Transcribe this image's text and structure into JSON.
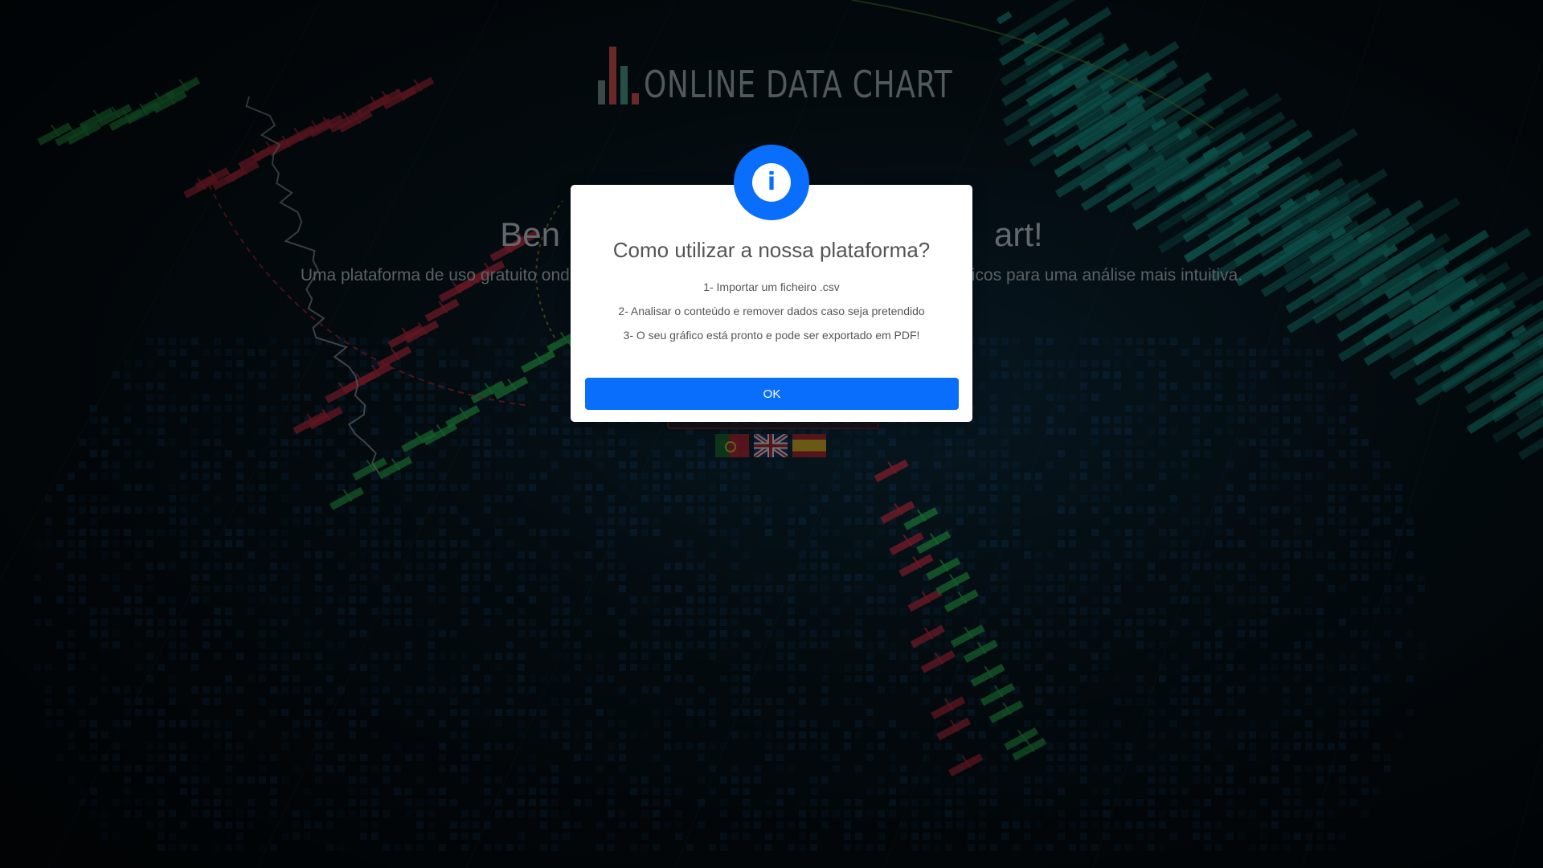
{
  "app": {
    "logo_text": "ONLINE DATA CHART",
    "hero_title_left": "Ben",
    "hero_title_right": "art!",
    "hero_subtitle_left": "Uma plataforma de uso gratuito ond",
    "hero_subtitle_right": "icos para uma análise mais intuitiva."
  },
  "languages": [
    {
      "code": "pt",
      "icon": "flag-portugal-icon"
    },
    {
      "code": "en",
      "icon": "flag-uk-icon"
    },
    {
      "code": "es",
      "icon": "flag-spain-icon"
    }
  ],
  "modal": {
    "icon": "info-icon",
    "icon_glyph": "i",
    "title": "Como utilizar a nossa plataforma?",
    "steps": [
      "1- Importar um ficheiro .csv",
      "2- Analisar o conteúdo e remover dados caso seja pretendido",
      "3- O seu gráfico está pronto e pode ser exportado em PDF!"
    ],
    "ok_label": "OK"
  },
  "colors": {
    "accent": "#0a6efd",
    "bull": "#2ec85a",
    "bear": "#e0344d",
    "teal": "#1fbfb0"
  }
}
